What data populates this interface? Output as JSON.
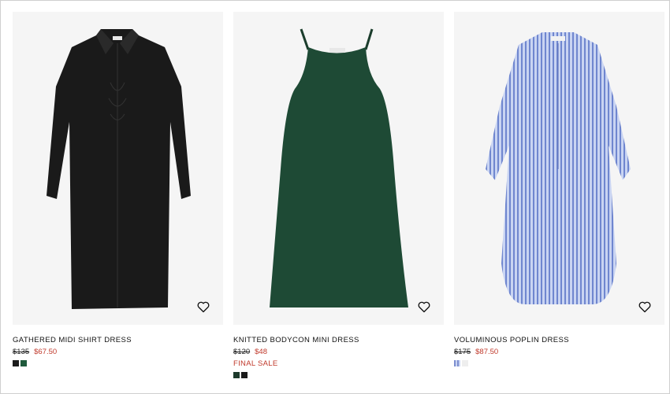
{
  "products": [
    {
      "name": "GATHERED MIDI SHIRT DRESS",
      "old_price": "$135",
      "new_price": "$67.50",
      "label": "",
      "swatches": [
        "#1b1b1b",
        "#1f5a3c"
      ],
      "garment_color": "#1a1a1a"
    },
    {
      "name": "KNITTED BODYCON MINI DRESS",
      "old_price": "$120",
      "new_price": "$48",
      "label": "FINAL SALE",
      "swatches": [
        "#1d3a2c",
        "#1b1b1b"
      ],
      "garment_color": "#1e4a35"
    },
    {
      "name": "VOLUMINOUS POPLIN DRESS",
      "old_price": "$175",
      "new_price": "$87.50",
      "label": "",
      "swatches": [
        "#7d8fd0",
        "#eeeeee"
      ],
      "garment_color": "#9fb3e6"
    }
  ]
}
